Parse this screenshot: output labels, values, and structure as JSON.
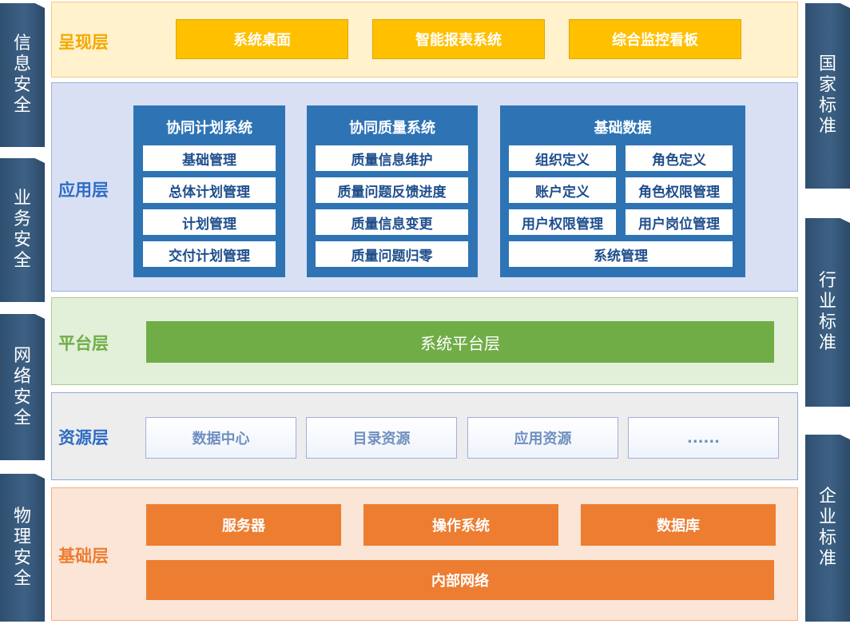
{
  "left_side": [
    "信息安全",
    "业务安全",
    "网络安全",
    "物理安全"
  ],
  "right_side": [
    "国家标准",
    "行业标准",
    "企业标准"
  ],
  "presentation": {
    "title": "呈现层",
    "items": [
      "系统桌面",
      "智能报表系统",
      "综合监控看板"
    ]
  },
  "application": {
    "title": "应用层",
    "plan": {
      "title": "协同计划系统",
      "items": [
        "基础管理",
        "总体计划管理",
        "计划管理",
        "交付计划管理"
      ]
    },
    "quality": {
      "title": "协同质量系统",
      "items": [
        "质量信息维护",
        "质量问题反馈进度",
        "质量信息变更",
        "质量问题归零"
      ]
    },
    "base": {
      "title": "基础数据",
      "items": [
        "组织定义",
        "角色定义",
        "账户定义",
        "角色权限管理",
        "用户权限管理",
        "用户岗位管理",
        "系统管理"
      ]
    }
  },
  "platform": {
    "title": "平台层",
    "bar": "系统平台层"
  },
  "resource": {
    "title": "资源层",
    "items": [
      "数据中心",
      "目录资源",
      "应用资源",
      "......"
    ]
  },
  "foundation": {
    "title": "基础层",
    "items": [
      "服务器",
      "操作系统",
      "数据库"
    ],
    "network": "内部网络"
  }
}
